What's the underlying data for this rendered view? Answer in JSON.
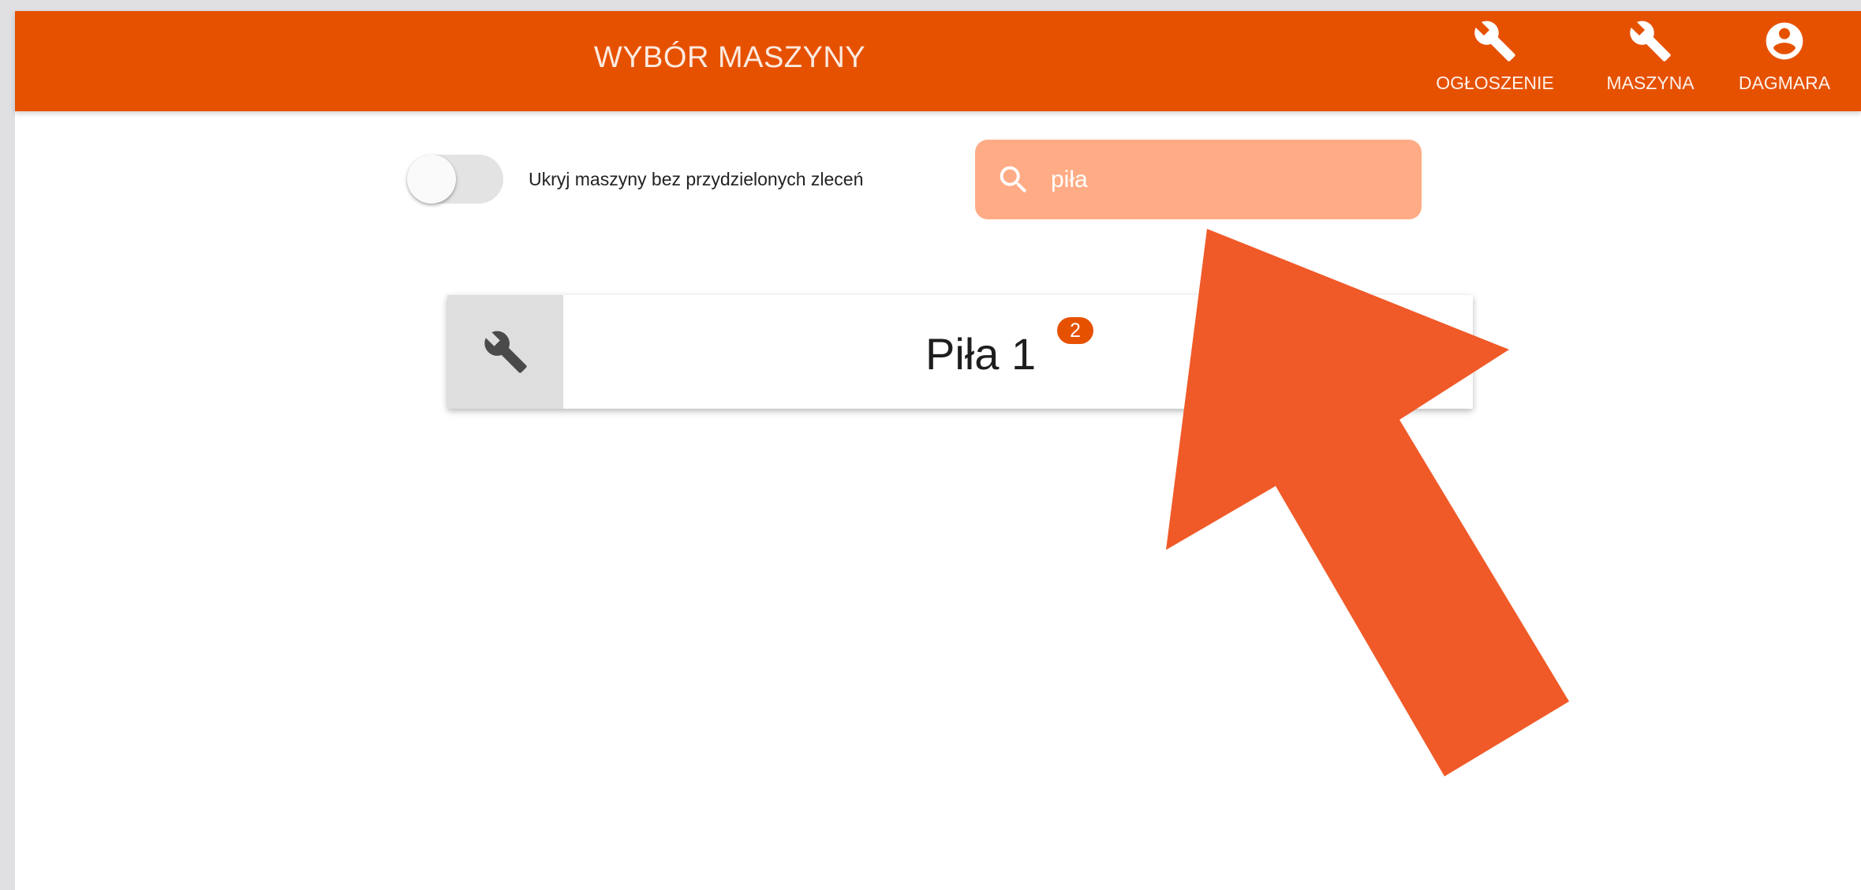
{
  "header": {
    "title": "WYBÓR MASZYNY",
    "nav": [
      {
        "label": "OGŁOSZENIE",
        "icon": "wrench-icon"
      },
      {
        "label": "MASZYNA",
        "icon": "wrench-icon"
      },
      {
        "label": "DAGMARA",
        "icon": "account-circle-icon"
      }
    ]
  },
  "filter": {
    "toggle_label": "Ukryj maszyny bez przydzielonych zleceń",
    "toggle_on": false
  },
  "search": {
    "value": "piła",
    "icon": "search-icon"
  },
  "machines": [
    {
      "name": "Piła 1",
      "badge": "2",
      "icon": "wrench-icon"
    }
  ],
  "colors": {
    "header": "#e65100",
    "search_background": "#ffac86",
    "badge": "#e65100",
    "annotation_arrow": "#f05a28"
  }
}
